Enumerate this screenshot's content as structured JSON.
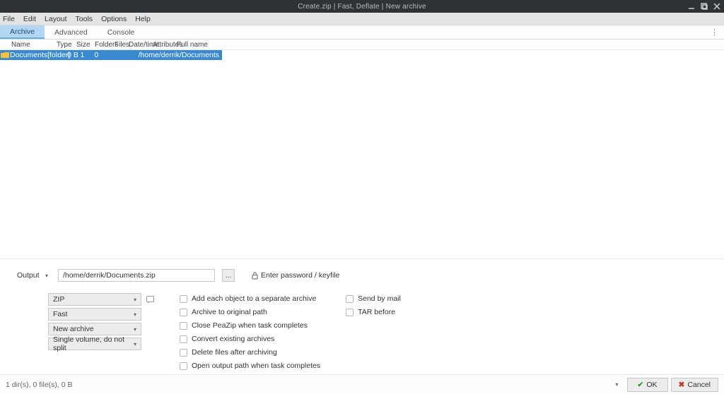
{
  "window": {
    "title": "Create.zip  |  Fast, Deflate  |  New archive"
  },
  "menu": {
    "items": [
      "File",
      "Edit",
      "Layout",
      "Tools",
      "Options",
      "Help"
    ]
  },
  "tabs": {
    "items": [
      "Archive",
      "Advanced",
      "Console"
    ],
    "active_index": 0
  },
  "columns": {
    "name": "Name",
    "type": "Type",
    "size": "Size",
    "folders": "Folders",
    "files": "Files",
    "datetime": "Date/time",
    "attributes": "Attributes",
    "fullname": "Full name"
  },
  "rows": [
    {
      "name": "Documents",
      "type": "[folder]",
      "size": "0 B",
      "folders": "1",
      "files": "0",
      "datetime": "",
      "attributes": "",
      "fullname": "/home/derrik/Documents",
      "selected": true
    }
  ],
  "output": {
    "label": "Output",
    "path": "/home/derrik/Documents.zip",
    "browse": "...",
    "password_label": "Enter password / keyfile"
  },
  "format_combos": {
    "type": "ZIP",
    "level": "Fast",
    "mode": "New archive",
    "split": "Single volume, do not split"
  },
  "checkboxes_col1": [
    "Add each object to a separate archive",
    "Archive to original path",
    "Close PeaZip when task completes",
    "Convert existing archives",
    "Delete files after archiving",
    "Open output path when task completes"
  ],
  "checkboxes_col2": [
    "Send by mail",
    "TAR before"
  ],
  "actionbar": {
    "status": "1 dir(s), 0 file(s), 0 B",
    "ok": "OK",
    "cancel": "Cancel"
  }
}
